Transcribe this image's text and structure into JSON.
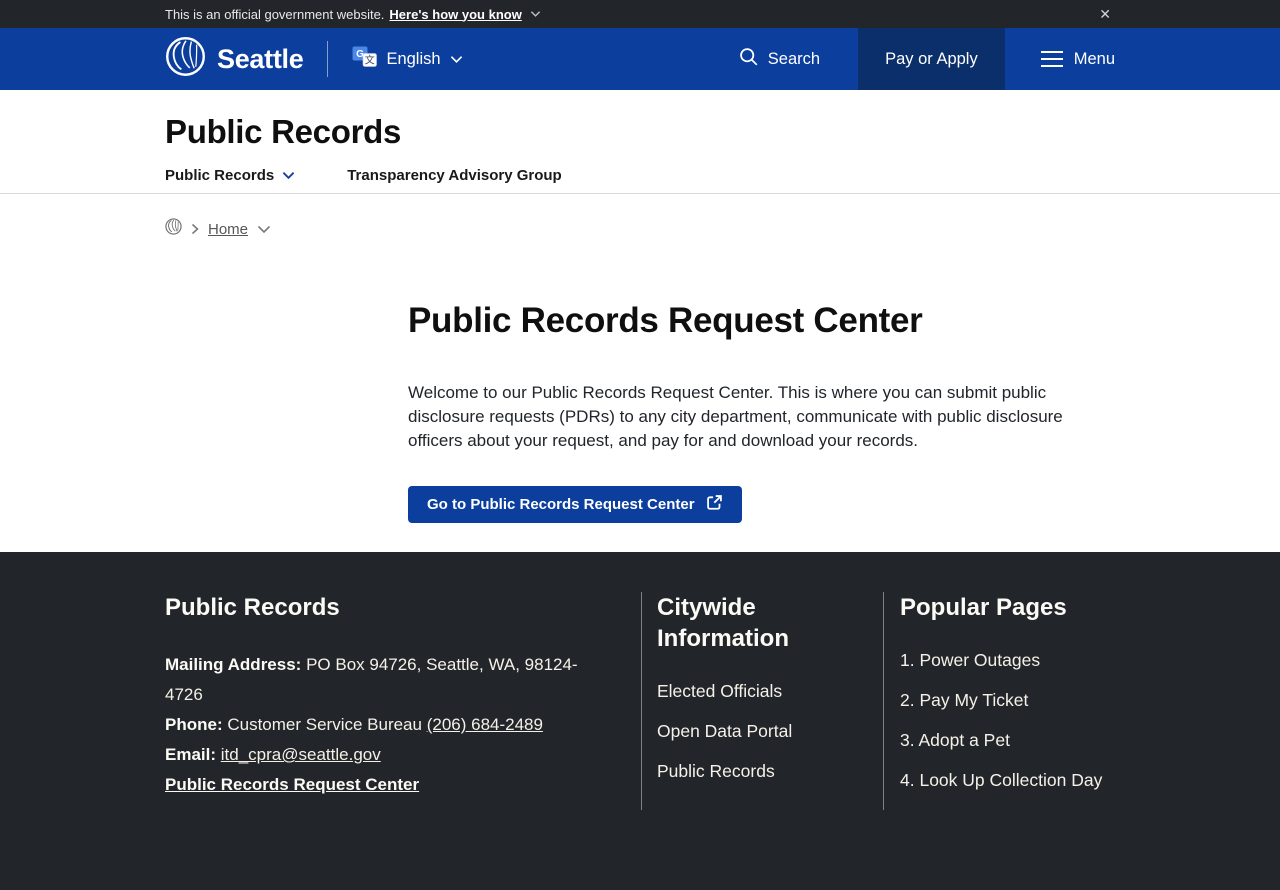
{
  "colors": {
    "header_blue": "#0c3e9d",
    "pay_button_blue": "#0b2f6b",
    "dark_charcoal": "#22252a",
    "footer_cream": "#f5f1e8"
  },
  "icons": [
    "close-icon",
    "seattle-logo",
    "translate-icon",
    "chevron-down-icon",
    "search-icon",
    "hamburger-icon",
    "breadcrumb-logo",
    "chevron-right-icon",
    "external-link-icon"
  ],
  "banner": {
    "text": "This is an official government website.",
    "link_label": "Here's how you know",
    "close_label": "✕"
  },
  "header": {
    "brand": "Seattle",
    "language_label": "English",
    "search_label": "Search",
    "pay_label": "Pay or Apply",
    "menu_label": "Menu"
  },
  "page": {
    "title": "Public Records",
    "nav": [
      {
        "label": "Public Records"
      },
      {
        "label": "Transparency Advisory Group"
      }
    ]
  },
  "breadcrumb": {
    "home_label": "Home"
  },
  "main": {
    "heading": "Public Records Request Center",
    "intro": "Welcome to our Public Records Request Center. This is where you can submit public disclosure requests (PDRs) to any city department, communicate with public disclosure officers about your request, and pay for and download your records.",
    "cta_label": "Go to Public Records Request Center"
  },
  "footer": {
    "records": {
      "heading": "Public Records",
      "mailing_label": "Mailing Address:",
      "mailing_value": " PO Box 94726, Seattle, WA, 98124-4726",
      "phone_label": "Phone:",
      "phone_prefix": " Customer Service Bureau ",
      "phone_link": "(206) 684-2489",
      "email_label": "Email:",
      "email_link": "itd_cpra@seattle.gov",
      "request_center_link": "Public Records Request Center"
    },
    "citywide": {
      "heading": "Citywide Information",
      "links": [
        "Elected Officials",
        "Open Data Portal",
        "Public Records"
      ]
    },
    "popular": {
      "heading": "Popular Pages",
      "links": [
        "1. Power Outages",
        "2. Pay My Ticket",
        "3. Adopt a Pet",
        "4. Look Up Collection Day"
      ]
    }
  }
}
